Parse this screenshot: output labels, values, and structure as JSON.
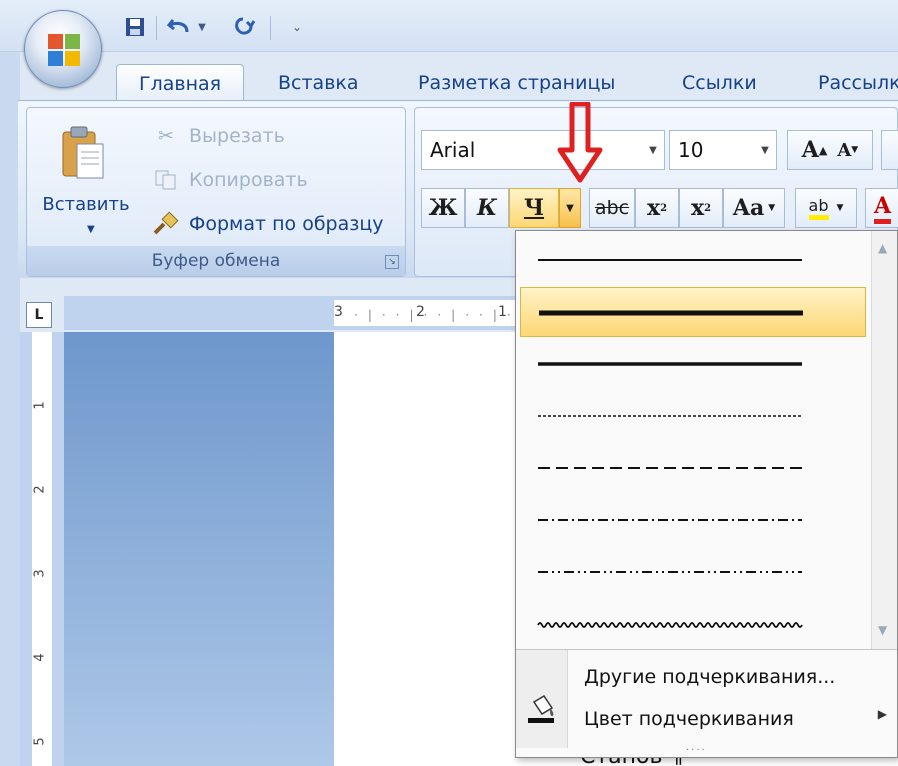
{
  "qat": {
    "icons": [
      "save-icon",
      "undo-icon",
      "dropdown-icon",
      "redo-icon",
      "customize-icon"
    ]
  },
  "tabs": [
    {
      "label": "Главная"
    },
    {
      "label": "Вставка"
    },
    {
      "label": "Разметка страницы"
    },
    {
      "label": "Ссылки"
    },
    {
      "label": "Рассылк"
    }
  ],
  "clipboard": {
    "paste_label": "Вставить",
    "cut_label": "Вырезать",
    "copy_label": "Копировать",
    "format_painter_label": "Формат по образцу",
    "group_label": "Буфер обмена"
  },
  "font": {
    "font_name": "Arial",
    "font_size": "10",
    "grow": "A",
    "shrink": "A",
    "bold": "Ж",
    "italic": "К",
    "underline": "Ч",
    "strikethrough": "abc",
    "subscript": "x",
    "superscript": "x",
    "change_case": "Aa",
    "highlight": "ab",
    "font_color": "A"
  },
  "ruler": {
    "tab_stop": "L",
    "h_ticks": [
      "3",
      "2",
      "1"
    ],
    "v_ticks": [
      "1",
      "2",
      "3",
      "4",
      "5"
    ]
  },
  "page_text": "Стапов ¶",
  "underline_menu": {
    "styles": [
      "single",
      "thick",
      "medium",
      "dotted",
      "dashed",
      "dash-dot",
      "dash-dot-dot",
      "wave"
    ],
    "hovered_index": 1,
    "other_label": "Другие подчеркивания...",
    "color_label": "Цвет подчеркивания"
  },
  "colors": {
    "accent": "#15428b",
    "hover": "#fcd774",
    "arrow": "#e02020",
    "font_color_bar": "#e02020",
    "highlight_bar": "#ffee00"
  }
}
